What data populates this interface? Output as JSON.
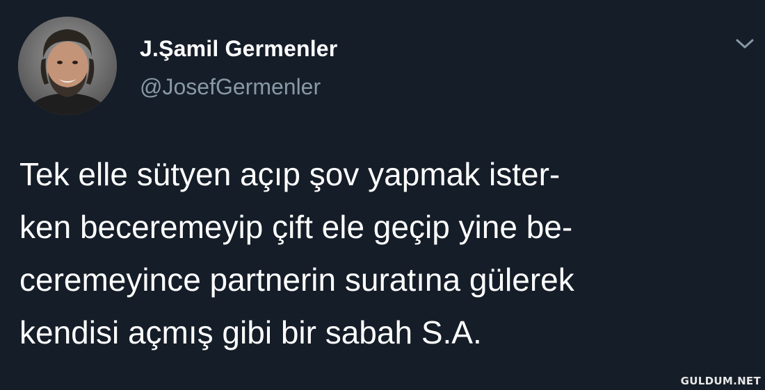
{
  "tweet": {
    "author": {
      "display_name": "J.Şamil Germenler",
      "handle": "@JosefGermenler"
    },
    "menu_icon": "chevron-down-icon",
    "text_lines": [
      "Tek elle sütyen açıp şov yapmak ister-",
      "ken beceremeyip çift ele geçip yine be-",
      "ceremeyince partnerin suratına gülerek",
      "kendisi açmış gibi bir sabah S.A."
    ]
  },
  "watermark": "GULDUM.NET",
  "colors": {
    "background": "#151d28",
    "text": "#ffffff",
    "handle": "#8899a6",
    "chevron": "#8899a6"
  }
}
